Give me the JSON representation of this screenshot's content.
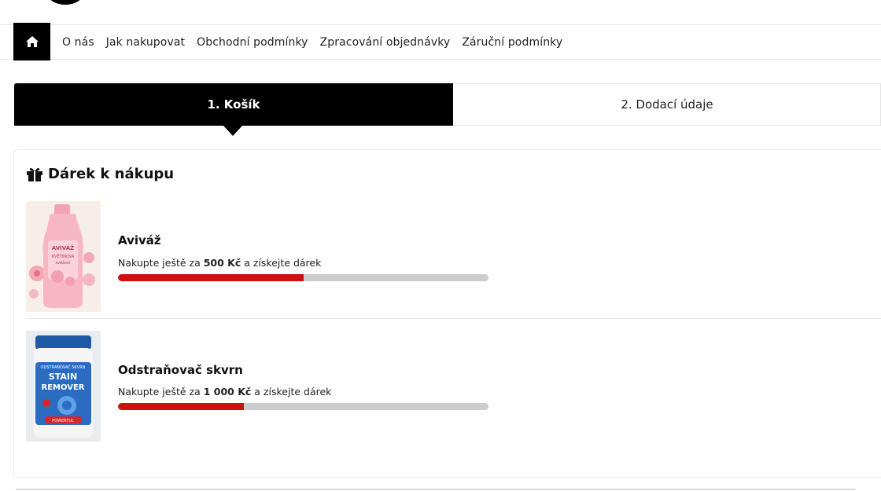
{
  "nav": {
    "home_label": "Home",
    "links": [
      "O nás",
      "Jak nakupovat",
      "Obchodní podmínky",
      "Zpracování objednávky",
      "Záruční podmínky"
    ]
  },
  "steps": {
    "active": "1. Košík",
    "next": "2. Dodací údaje"
  },
  "gifts": {
    "title": "Dárek k nákupu",
    "icon": "gift-icon",
    "items": [
      {
        "name": "Aviváž",
        "text_before": "Nakupte ještě za ",
        "amount": "500 Kč",
        "text_after": " a získejte dárek",
        "progress": 0.5,
        "image_label_1": "AVIVÁŽ",
        "image_label_2": "KVĚTINOVÁ",
        "image_label_3": "svěžest"
      },
      {
        "name": "Odstraňovač skvrn",
        "text_before": "Nakupte ještě za ",
        "amount": "1 000 Kč",
        "text_after": " a získejte dárek",
        "progress": 0.34,
        "image_label_1": "ODSTRAŇOVAČ SKVRN",
        "image_label_2": "STAIN",
        "image_label_3": "REMOVER",
        "image_label_4": "POWERFUL"
      }
    ]
  },
  "colors": {
    "accent": "#000000",
    "progress_fill": "#cc1111",
    "progress_track": "#cccccc"
  }
}
